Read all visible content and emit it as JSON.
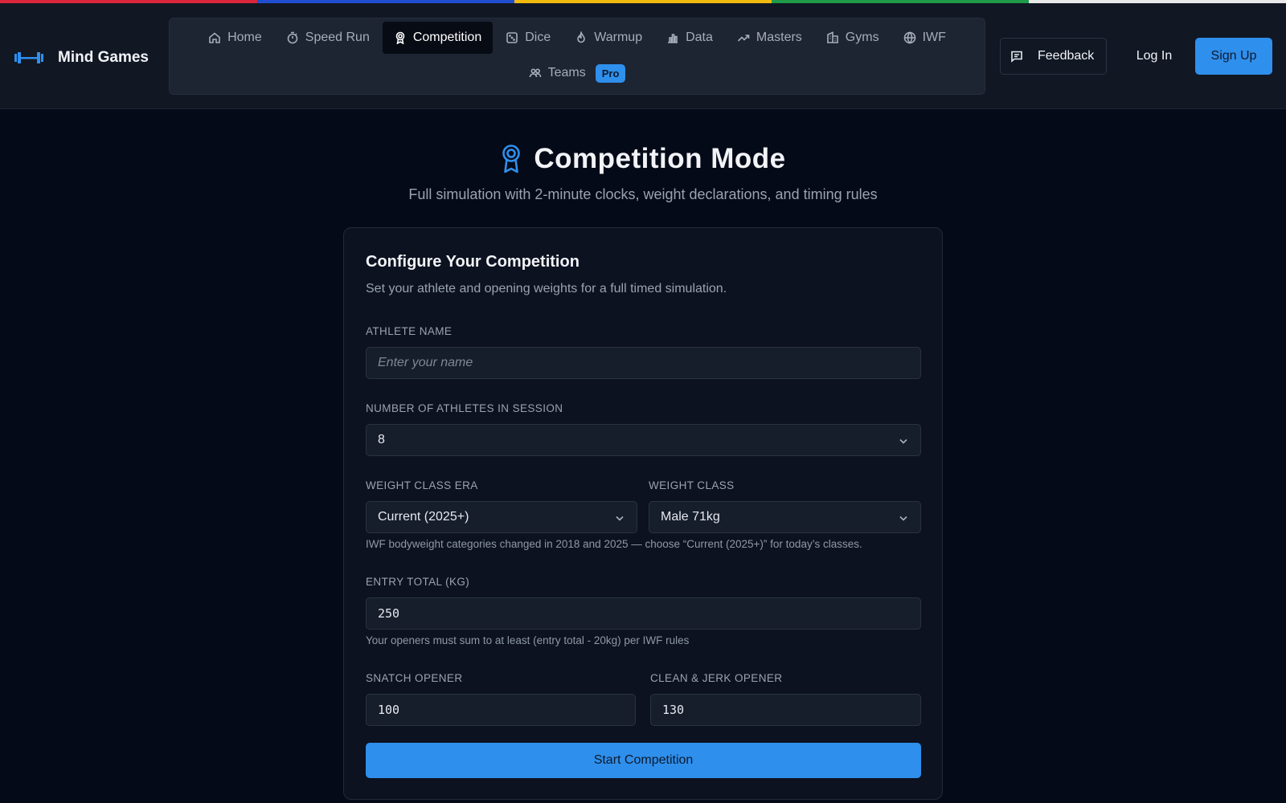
{
  "brand": {
    "name": "Mind Games",
    "logo_icon": "barbell-icon"
  },
  "nav": {
    "items": [
      {
        "label": "Home",
        "icon": "home-icon",
        "active": false
      },
      {
        "label": "Speed Run",
        "icon": "stopwatch-icon",
        "active": false
      },
      {
        "label": "Competition",
        "icon": "award-icon",
        "active": true
      },
      {
        "label": "Dice",
        "icon": "dice-icon",
        "active": false
      },
      {
        "label": "Warmup",
        "icon": "flame-icon",
        "active": false
      },
      {
        "label": "Data",
        "icon": "bar-chart-icon",
        "active": false
      },
      {
        "label": "Masters",
        "icon": "trending-up-icon",
        "active": false
      },
      {
        "label": "Gyms",
        "icon": "building-icon",
        "active": false
      },
      {
        "label": "IWF",
        "icon": "globe-icon",
        "active": false
      }
    ],
    "teams": {
      "label": "Teams",
      "icon": "users-icon",
      "badge": "Pro"
    }
  },
  "header_actions": {
    "feedback_label": "Feedback",
    "login_label": "Log In",
    "signup_label": "Sign Up"
  },
  "page": {
    "title": "Competition Mode",
    "subtitle": "Full simulation with 2-minute clocks, weight declarations, and timing rules"
  },
  "form": {
    "title": "Configure Your Competition",
    "description": "Set your athlete and opening weights for a full timed simulation.",
    "athlete_name": {
      "label": "ATHLETE NAME",
      "placeholder": "Enter your name",
      "value": ""
    },
    "num_athletes": {
      "label": "NUMBER OF ATHLETES IN SESSION",
      "value": "8"
    },
    "weight_class_era": {
      "label": "WEIGHT CLASS ERA",
      "value": "Current (2025+)"
    },
    "weight_class": {
      "label": "WEIGHT CLASS",
      "value": "Male 71kg"
    },
    "era_help": "IWF bodyweight categories changed in 2018 and 2025 — choose “Current (2025+)” for today’s classes.",
    "entry_total": {
      "label": "ENTRY TOTAL (KG)",
      "value": "250"
    },
    "entry_help": "Your openers must sum to at least (entry total - 20kg) per IWF rules",
    "snatch_opener": {
      "label": "SNATCH OPENER",
      "value": "100"
    },
    "cj_opener": {
      "label": "CLEAN & JERK OPENER",
      "value": "130"
    },
    "submit_label": "Start Competition"
  },
  "colors": {
    "accent": "#2f8fec",
    "background": "#050a18",
    "strip": [
      "#d9263a",
      "#1f4fd0",
      "#f2b90f",
      "#1f9a48",
      "#e9e9e9"
    ]
  }
}
